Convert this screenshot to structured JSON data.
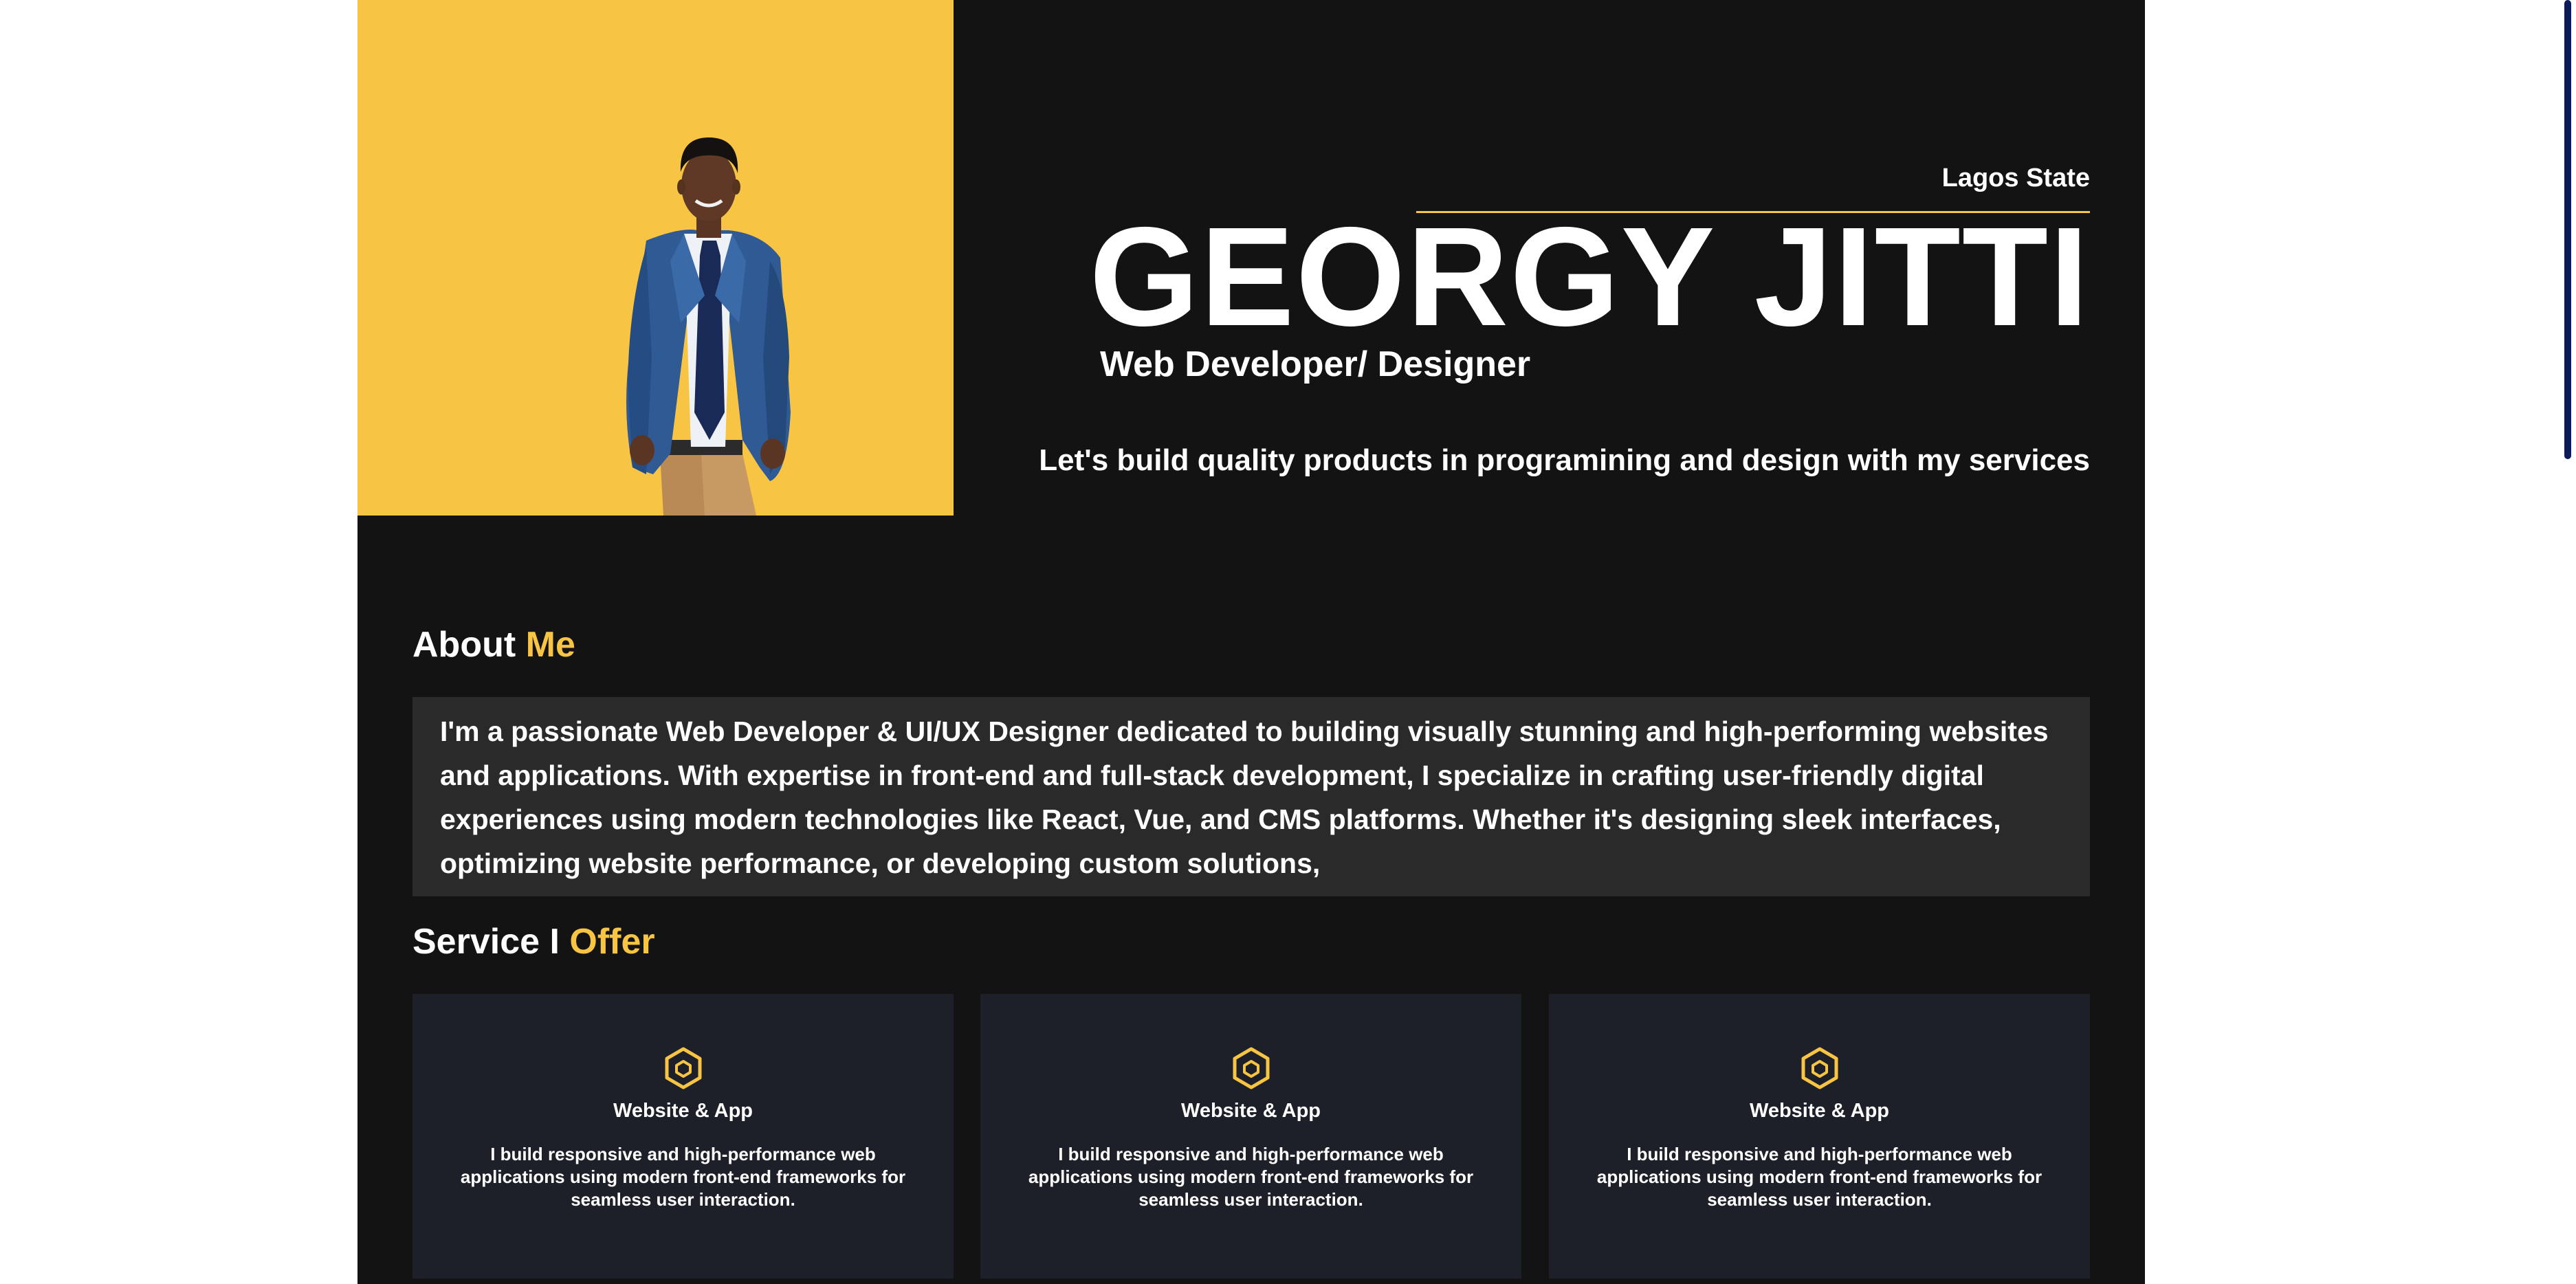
{
  "hero": {
    "location": "Lagos State",
    "name": "GEORGY JITTI",
    "role": "Web Developer/ Designer",
    "tagline": "Let's build quality products in programining and design with my services",
    "accent_color": "#f8c443",
    "background_color": "#131313"
  },
  "about": {
    "heading_main": "About",
    "heading_accent": "Me",
    "text": "I'm a passionate Web Developer & UI/UX Designer dedicated to building visually stunning and high-performing websites and applications. With expertise in front-end and full-stack development, I specialize in crafting user-friendly digital experiences using modern technologies like React, Vue, and CMS platforms. Whether it's designing sleek interfaces, optimizing website performance, or developing custom solutions,"
  },
  "services": {
    "heading_main": "Service I",
    "heading_accent": "Offer",
    "cards": [
      {
        "icon": "hexagon-icon",
        "title": "Website & App",
        "description": "I build responsive and high-performance web applications using modern front-end frameworks for seamless user interaction."
      },
      {
        "icon": "hexagon-icon",
        "title": "Website & App",
        "description": "I build responsive and high-performance web applications using modern front-end frameworks for seamless user interaction."
      },
      {
        "icon": "hexagon-icon",
        "title": "Website & App",
        "description": "I build responsive and high-performance web applications using modern front-end frameworks for seamless user interaction."
      }
    ]
  }
}
